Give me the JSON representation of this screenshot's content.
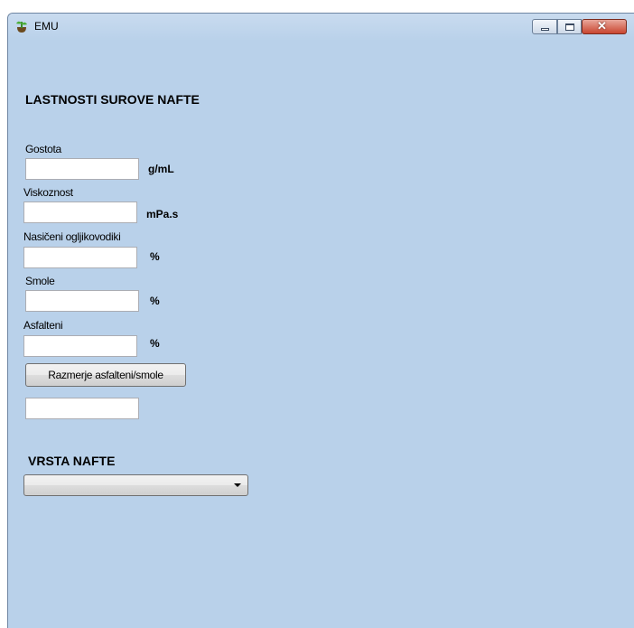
{
  "window": {
    "title": "EMU"
  },
  "properties": {
    "heading": "LASTNOSTI SUROVE NAFTE",
    "fields": [
      {
        "label": "Gostota",
        "value": "",
        "unit": "g/mL"
      },
      {
        "label": "Viskoznost",
        "value": "",
        "unit": "mPa.s"
      },
      {
        "label": "Nasičeni ogljikovodiki",
        "value": "",
        "unit": "%"
      },
      {
        "label": "Smole",
        "value": "",
        "unit": "%"
      },
      {
        "label": "Asfalteni",
        "value": "",
        "unit": "%"
      }
    ],
    "ratio_button_label": "Razmerje asfalteni/smole",
    "ratio_result": ""
  },
  "oil_type": {
    "heading": "VRSTA NAFTE",
    "selected": ""
  },
  "colors": {
    "form_background": "#b9d1ea",
    "close_button": "#c9452f"
  }
}
